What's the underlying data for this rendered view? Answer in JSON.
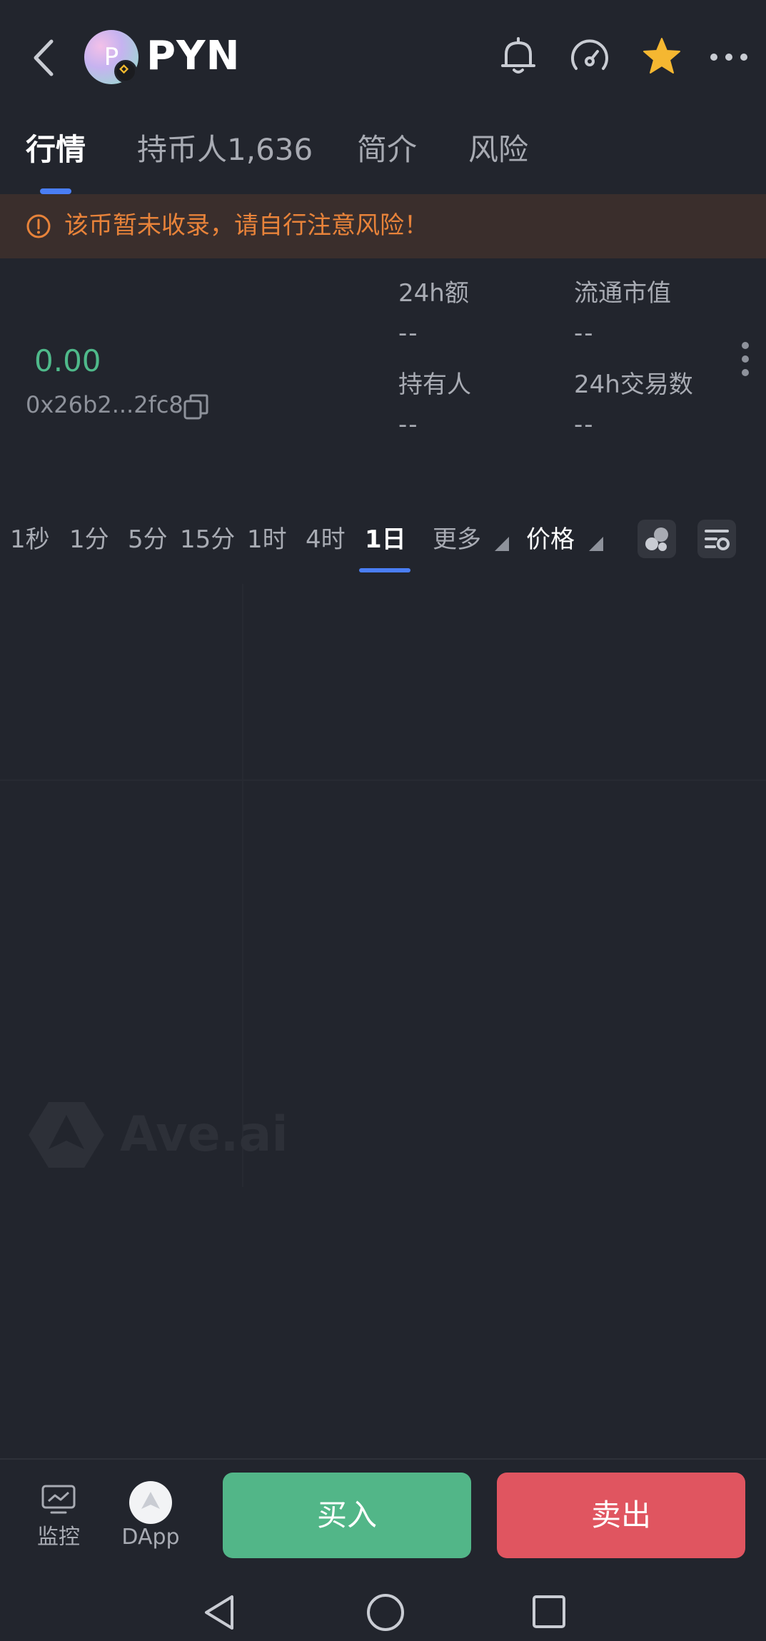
{
  "header": {
    "avatar_letter": "P",
    "token_name": "PYN",
    "favorite_color": "#f5b731"
  },
  "tabs": [
    {
      "label": "行情",
      "active": true
    },
    {
      "label": "持币人1,636",
      "active": false
    },
    {
      "label": "简介",
      "active": false
    },
    {
      "label": "风险",
      "active": false
    }
  ],
  "warning": {
    "text": "该币暂未收录，请自行注意风险！",
    "color": "#e8833a"
  },
  "token": {
    "price": "0.00",
    "address": "0x26b2...2fc8"
  },
  "stats": [
    {
      "label": "24h额",
      "value": "--"
    },
    {
      "label": "流通市值",
      "value": "--"
    },
    {
      "label": "持有人",
      "value": "--"
    },
    {
      "label": "24h交易数",
      "value": "--"
    }
  ],
  "intervals": [
    {
      "label": "1秒",
      "active": false
    },
    {
      "label": "1分",
      "active": false
    },
    {
      "label": "5分",
      "active": false
    },
    {
      "label": "15分",
      "active": false
    },
    {
      "label": "1时",
      "active": false
    },
    {
      "label": "4时",
      "active": false
    },
    {
      "label": "1日",
      "active": true
    }
  ],
  "chart_controls": {
    "more_label": "更多",
    "price_label": "价格"
  },
  "chart": {
    "watermark": "Ave.ai"
  },
  "bottom_bar": {
    "monitor_label": "监控",
    "dapp_label": "DApp",
    "buy_label": "买入",
    "sell_label": "卖出",
    "buy_color": "#52b688",
    "sell_color": "#e05560"
  }
}
